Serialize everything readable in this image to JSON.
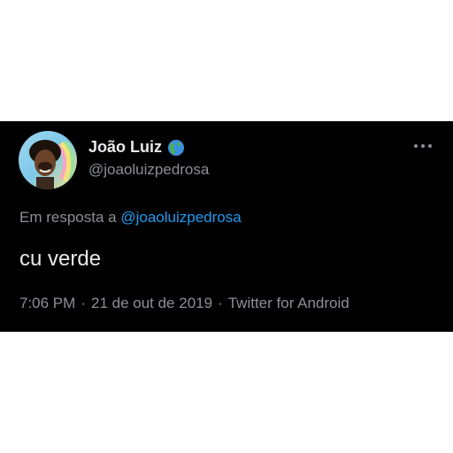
{
  "tweet": {
    "display_name": "João Luiz",
    "name_emoji_icon": "globe-americas-icon",
    "handle": "@joaoluizpedrosa",
    "reply_prefix": "Em resposta a",
    "reply_to": "@joaoluizpedrosa",
    "text": "cu verde",
    "time": "7:06 PM",
    "date": "21 de out de 2019",
    "source": "Twitter for Android",
    "separator": "·"
  },
  "colors": {
    "background": "#000000",
    "primary_text": "#e7e9ea",
    "secondary_text": "#8b9095",
    "link": "#1d9bf0"
  }
}
